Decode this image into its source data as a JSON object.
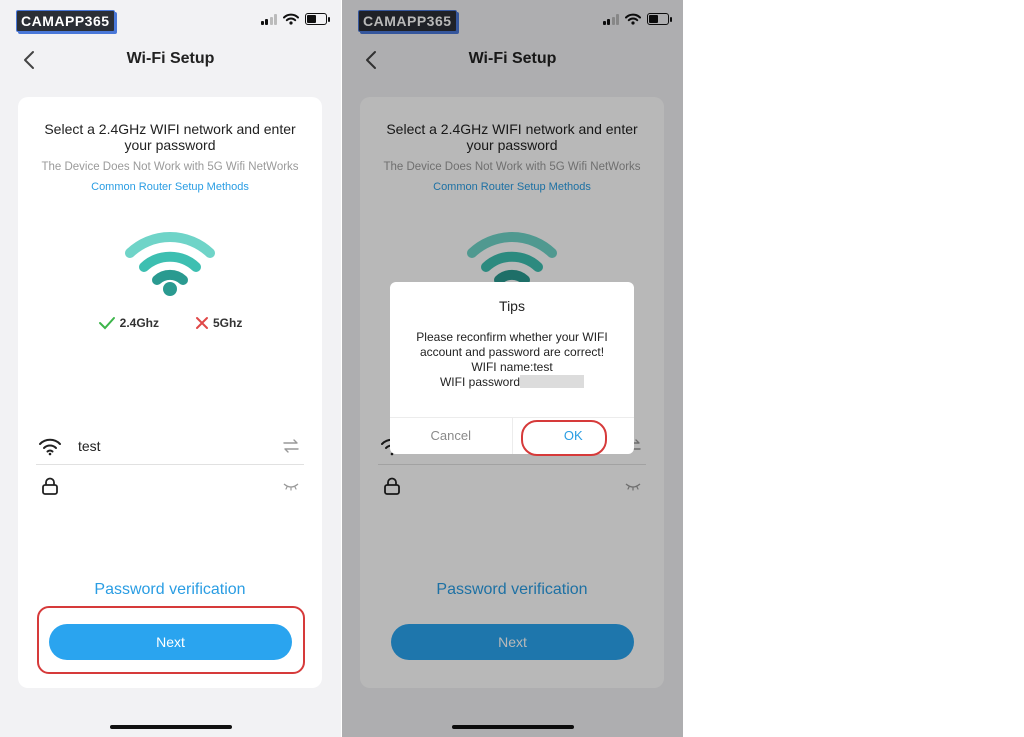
{
  "brand": "CAMAPP365",
  "header": {
    "title": "Wi-Fi Setup"
  },
  "card": {
    "headline": "Select a 2.4GHz WIFI network and enter your password",
    "subline": "The Device Does Not Work with 5G Wifi NetWorks",
    "router_link": "Common Router Setup Methods",
    "bands": {
      "supported": "2.4Ghz",
      "unsupported": "5Ghz"
    },
    "ssid_value": "test",
    "password_value": "",
    "password_verification": "Password verification",
    "next_label": "Next"
  },
  "dialog": {
    "title": "Tips",
    "message": "Please reconfirm whether your WIFI account and password are correct!",
    "wifi_name_line": "WIFI name:test",
    "wifi_password_prefix": "WIFI password",
    "cancel_label": "Cancel",
    "ok_label": "OK"
  },
  "colors": {
    "accent": "#2aa4ef",
    "link": "#2a9de3",
    "wifi_teal": "#3dbfb1",
    "check_green": "#3cb54a",
    "cross_red": "#e04848",
    "highlight_red": "#d63a3a"
  },
  "icons": [
    "back-chevron-icon",
    "wifi-signal-icon",
    "check-icon",
    "cross-icon",
    "wifi-icon",
    "swap-icon",
    "lock-icon",
    "eye-closed-icon"
  ]
}
